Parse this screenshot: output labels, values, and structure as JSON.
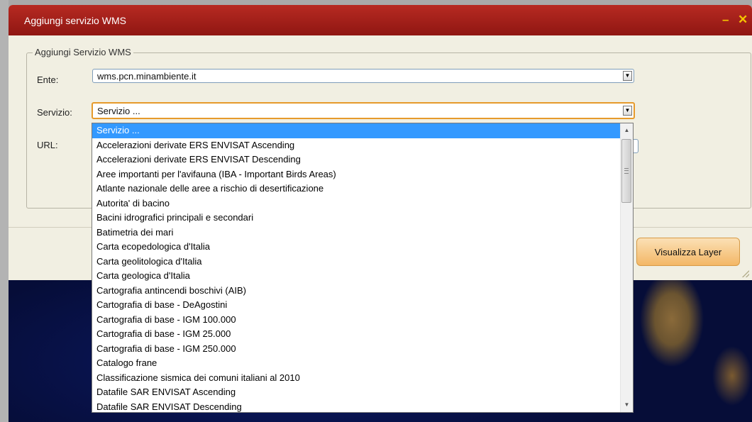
{
  "window": {
    "title": "Aggiungi servizio WMS",
    "minimize_glyph": "–",
    "close_glyph": "✕"
  },
  "form": {
    "legend": "Aggiungi Servizio WMS",
    "ente_label": "Ente:",
    "ente_value": "wms.pcn.minambiente.it",
    "servizio_label": "Servizio:",
    "servizio_value": "Servizio ...",
    "url_label": "URL:",
    "url_value": ""
  },
  "dropdown": {
    "items": [
      "Servizio ...",
      "Accelerazioni derivate ERS ENVISAT Ascending",
      "Accelerazioni derivate ERS ENVISAT Descending",
      "Aree importanti per l'avifauna (IBA - Important Birds Areas)",
      "Atlante nazionale delle aree a rischio di desertificazione",
      "Autorita' di bacino",
      "Bacini idrografici principali e secondari",
      "Batimetria dei mari",
      "Carta ecopedologica d'Italia",
      "Carta geolitologica d'Italia",
      "Carta geologica d'Italia",
      "Cartografia antincendi boschivi (AIB)",
      "Cartografia di base - DeAgostini",
      "Cartografia di base - IGM 100.000",
      "Cartografia di base - IGM 25.000",
      "Cartografia di base - IGM 250.000",
      "Catalogo frane",
      "Classificazione sismica dei comuni italiani al 2010",
      "Datafile SAR ENVISAT Ascending",
      "Datafile SAR ENVISAT Descending"
    ],
    "selected_index": 0
  },
  "buttons": {
    "visualizza": "Visualizza Layer"
  },
  "colors": {
    "titlebar": "#a61f1a",
    "accent_orange": "#e69a2b",
    "selection": "#3399ff"
  },
  "icons": [
    "minimize-icon",
    "close-icon",
    "dropdown-arrow-icon",
    "scroll-up-icon",
    "scroll-down-icon"
  ]
}
